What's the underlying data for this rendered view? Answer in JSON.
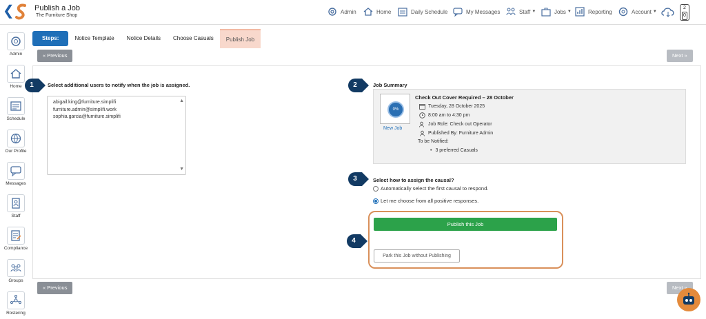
{
  "header": {
    "title": "Publish a Job",
    "subtitle": "The Furniture Shop",
    "nav": [
      {
        "label": "Admin"
      },
      {
        "label": "Home"
      },
      {
        "label": "Daily Schedule"
      },
      {
        "label": "My Messages"
      },
      {
        "label": "Staff"
      },
      {
        "label": "Jobs"
      },
      {
        "label": "Reporting"
      },
      {
        "label": "Account"
      }
    ],
    "notification_top": "2",
    "notification_bottom": "0"
  },
  "sidebar": {
    "items": [
      {
        "label": "Admin",
        "icon": "gear-icon"
      },
      {
        "label": "Home",
        "icon": "home-icon"
      },
      {
        "label": "Schedule",
        "icon": "schedule-icon"
      },
      {
        "label": "Our Profile",
        "icon": "globe-icon"
      },
      {
        "label": "Messages",
        "icon": "chat-icon"
      },
      {
        "label": "Staff",
        "icon": "staff-icon"
      },
      {
        "label": "Compliance",
        "icon": "compliance-icon"
      },
      {
        "label": "Groups",
        "icon": "groups-icon"
      },
      {
        "label": "Rostering",
        "icon": "rostering-icon"
      }
    ]
  },
  "steps": {
    "label": "Steps:",
    "items": [
      "Notice Template",
      "Notice Details",
      "Choose Casuals",
      "Publish Job"
    ],
    "active": "Publish Job"
  },
  "buttons": {
    "previous": "Previous",
    "next": "Next",
    "publish": "Publish this Job",
    "park": "Park this Job without Publishing"
  },
  "markers": [
    "1",
    "2",
    "3",
    "4"
  ],
  "notify": {
    "label": "Select additional users to notify when the job is assigned.",
    "users": [
      "abigail.king@furniture.simplifi",
      "furniture.admin@simplifi.work",
      "sophia.garcia@furniture.simplifi"
    ]
  },
  "summary": {
    "label": "Job Summary",
    "progress": "0%",
    "status": "New Job",
    "title": "Check Out Cover Required – 28 October",
    "date": "Tuesday, 28 October 2025",
    "time": "8:00 am to 4:30 pm",
    "role": "Job Role: Check out Operator",
    "published_by": "Published By: Furniture Admin",
    "to_be_notified": "To be Notified:",
    "notified_item": "3 preferred Casuals"
  },
  "assign": {
    "label": "Select how to assign the causal?",
    "options": [
      {
        "label": "Automatically select the first causal to respond.",
        "selected": false
      },
      {
        "label": "Let me choose from all positive responses.",
        "selected": true
      }
    ]
  },
  "colors": {
    "primary": "#1f6fb8",
    "publish_green": "#2ca24a",
    "highlight_orange": "#d9905a",
    "marker_navy": "#123a63"
  }
}
